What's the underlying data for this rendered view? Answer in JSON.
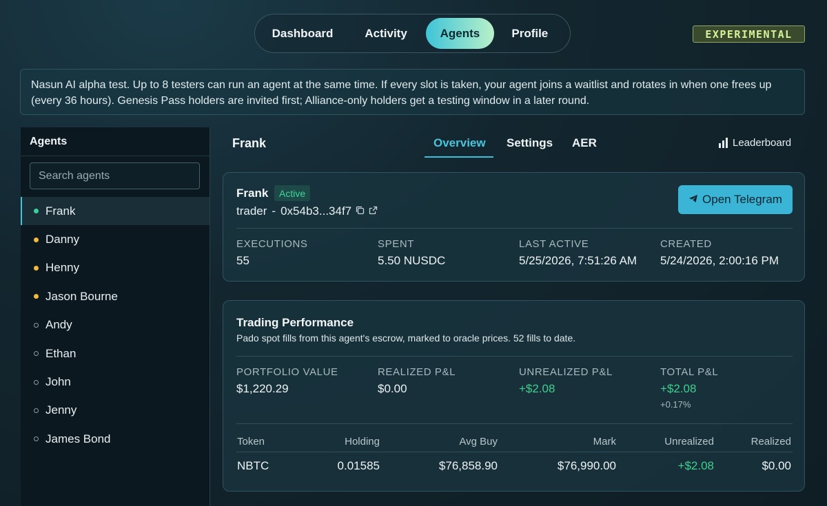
{
  "nav": {
    "tabs": [
      {
        "label": "Dashboard"
      },
      {
        "label": "Activity"
      },
      {
        "label": "Agents"
      },
      {
        "label": "Profile"
      }
    ],
    "active": "Agents",
    "badge": "EXPERIMENTAL"
  },
  "notice": {
    "text": "Nasun AI alpha test. Up to 8 testers can run an agent at the same time. If every slot is taken, your agent joins a waitlist and rotates in when one frees up (every 36 hours). Genesis Pass holders are invited first; Alliance-only holders get a testing window in a later round."
  },
  "sidebar": {
    "title": "Agents",
    "search_placeholder": "Search agents",
    "items": [
      {
        "label": "Frank",
        "status": "active"
      },
      {
        "label": "Danny",
        "status": "pending"
      },
      {
        "label": "Henny",
        "status": "pending"
      },
      {
        "label": "Jason Bourne",
        "status": "pending"
      },
      {
        "label": "Andy",
        "status": "idle"
      },
      {
        "label": "Ethan",
        "status": "idle"
      },
      {
        "label": "John",
        "status": "idle"
      },
      {
        "label": "Jenny",
        "status": "idle"
      },
      {
        "label": "James Bond",
        "status": "idle"
      }
    ]
  },
  "main": {
    "agent_name": "Frank",
    "tabs": [
      {
        "label": "Overview"
      },
      {
        "label": "Settings"
      },
      {
        "label": "AER"
      }
    ],
    "active_tab": "Overview",
    "leaderboard_label": "Leaderboard"
  },
  "agent_card": {
    "name": "Frank",
    "status": "Active",
    "role": "trader",
    "separator": "-",
    "address": "0x54b3...34f7",
    "telegram_button": "Open Telegram",
    "stats": [
      {
        "label": "EXECUTIONS",
        "value": "55"
      },
      {
        "label": "SPENT",
        "value": "5.50 NUSDC"
      },
      {
        "label": "LAST ACTIVE",
        "value": "5/25/2026, 7:51:26 AM"
      },
      {
        "label": "CREATED",
        "value": "5/24/2026, 2:00:16 PM"
      }
    ]
  },
  "performance": {
    "title": "Trading Performance",
    "description": "Pado spot fills from this agent's escrow, marked to oracle prices. 52 fills to date.",
    "stats": [
      {
        "label": "PORTFOLIO VALUE",
        "value": "$1,220.29"
      },
      {
        "label": "REALIZED P&L",
        "value": "$0.00"
      },
      {
        "label": "UNREALIZED P&L",
        "value": "+$2.08"
      },
      {
        "label": "TOTAL P&L",
        "value": "+$2.08",
        "sub": "+0.17%"
      }
    ],
    "table": {
      "headers": [
        "Token",
        "Holding",
        "Avg Buy",
        "Mark",
        "Unrealized",
        "Realized"
      ],
      "rows": [
        [
          "NBTC",
          "0.01585",
          "$76,858.90",
          "$76,990.00",
          "+$2.08",
          "$0.00"
        ]
      ]
    }
  },
  "colors": {
    "accent": "#3fc0d9",
    "positive": "#3fcf8e",
    "active_dot": "#35d39a",
    "pending_dot": "#f3b93a"
  }
}
